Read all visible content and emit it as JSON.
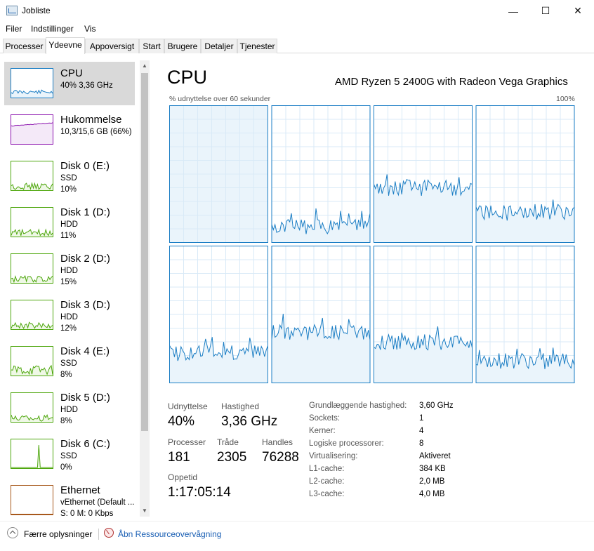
{
  "window": {
    "title": "Jobliste",
    "icon": "task-manager-icon",
    "min_glyph": "—",
    "max_glyph": "☐",
    "close_glyph": "✕"
  },
  "menu": [
    "Filer",
    "Indstillinger",
    "Vis"
  ],
  "tabs": [
    "Processer",
    "Ydeevne",
    "Appoversigt",
    "Start",
    "Brugere",
    "Detaljer",
    "Tjenester"
  ],
  "active_tab": "Ydeevne",
  "sidebar": {
    "items": [
      {
        "name": "CPU",
        "sub1": "40% 3,36 GHz",
        "sub2": "",
        "sub3": "",
        "kind": "cpu",
        "color": "#1a7dc4",
        "fill": "#eaf4fb"
      },
      {
        "name": "Hukommelse",
        "sub1": "10,3/15,6 GB (66%)",
        "sub2": "",
        "sub3": "",
        "kind": "mem",
        "color": "#8b12ae",
        "fill": "#f4e9f8"
      },
      {
        "name": "Disk 0 (E:)",
        "sub1": "SSD",
        "sub2": "10%",
        "sub3": "",
        "kind": "disk",
        "color": "#4da60c",
        "fill": "#eff8e6"
      },
      {
        "name": "Disk 1 (D:)",
        "sub1": "HDD",
        "sub2": "11%",
        "sub3": "",
        "kind": "disk",
        "color": "#4da60c",
        "fill": "#eff8e6"
      },
      {
        "name": "Disk 2 (D:)",
        "sub1": "HDD",
        "sub2": "15%",
        "sub3": "",
        "kind": "disk",
        "color": "#4da60c",
        "fill": "#eff8e6"
      },
      {
        "name": "Disk 3 (D:)",
        "sub1": "HDD",
        "sub2": "12%",
        "sub3": "",
        "kind": "disk",
        "color": "#4da60c",
        "fill": "#eff8e6"
      },
      {
        "name": "Disk 4 (E:)",
        "sub1": "SSD",
        "sub2": "8%",
        "sub3": "",
        "kind": "disk",
        "color": "#4da60c",
        "fill": "#eff8e6"
      },
      {
        "name": "Disk 5 (D:)",
        "sub1": "HDD",
        "sub2": "8%",
        "sub3": "",
        "kind": "disk",
        "color": "#4da60c",
        "fill": "#eff8e6"
      },
      {
        "name": "Disk 6 (C:)",
        "sub1": "SSD",
        "sub2": "0%",
        "sub3": "",
        "kind": "disk",
        "color": "#4da60c",
        "fill": "#eff8e6"
      },
      {
        "name": "Ethernet",
        "sub1": "vEthernet (Default ...",
        "sub2": "S: 0 M: 0 Kbps",
        "sub3": "",
        "kind": "net",
        "color": "#a7581b",
        "fill": "#fbf1ea"
      }
    ]
  },
  "main": {
    "title": "CPU",
    "model": "AMD Ryzen 5 2400G with Radeon Vega Graphics",
    "graph_caption": "% udnyttelse over 60 sekunder",
    "graph_max": "100%",
    "core_levels": [
      0,
      0.12,
      0.4,
      0.22,
      0.22,
      0.37,
      0.3,
      0.16
    ],
    "graph_color": "#1a7dc4",
    "graph_fill": "#eaf4fb",
    "grid_color": "#d9eaf7"
  },
  "stats": {
    "utilization_label": "Udnyttelse",
    "utilization": "40%",
    "speed_label": "Hastighed",
    "speed": "3,36 GHz",
    "processes_label": "Processer",
    "processes": "181",
    "threads_label": "Tråde",
    "threads": "2305",
    "handles_label": "Handles",
    "handles": "76288",
    "uptime_label": "Oppetid",
    "uptime": "1:17:05:14"
  },
  "specs": [
    {
      "label": "Grundlæggende hastighed:",
      "value": "3,60 GHz"
    },
    {
      "label": "Sockets:",
      "value": "1"
    },
    {
      "label": "Kerner:",
      "value": "4"
    },
    {
      "label": "Logiske processorer:",
      "value": "8"
    },
    {
      "label": "Virtualisering:",
      "value": "Aktiveret"
    },
    {
      "label": "L1-cache:",
      "value": "384 KB"
    },
    {
      "label": "L2-cache:",
      "value": "2,0 MB"
    },
    {
      "label": "L3-cache:",
      "value": "4,0 MB"
    }
  ],
  "footer": {
    "fewer_label": "Færre oplysninger",
    "resource_link": "Åbn Ressourceovervågning"
  }
}
